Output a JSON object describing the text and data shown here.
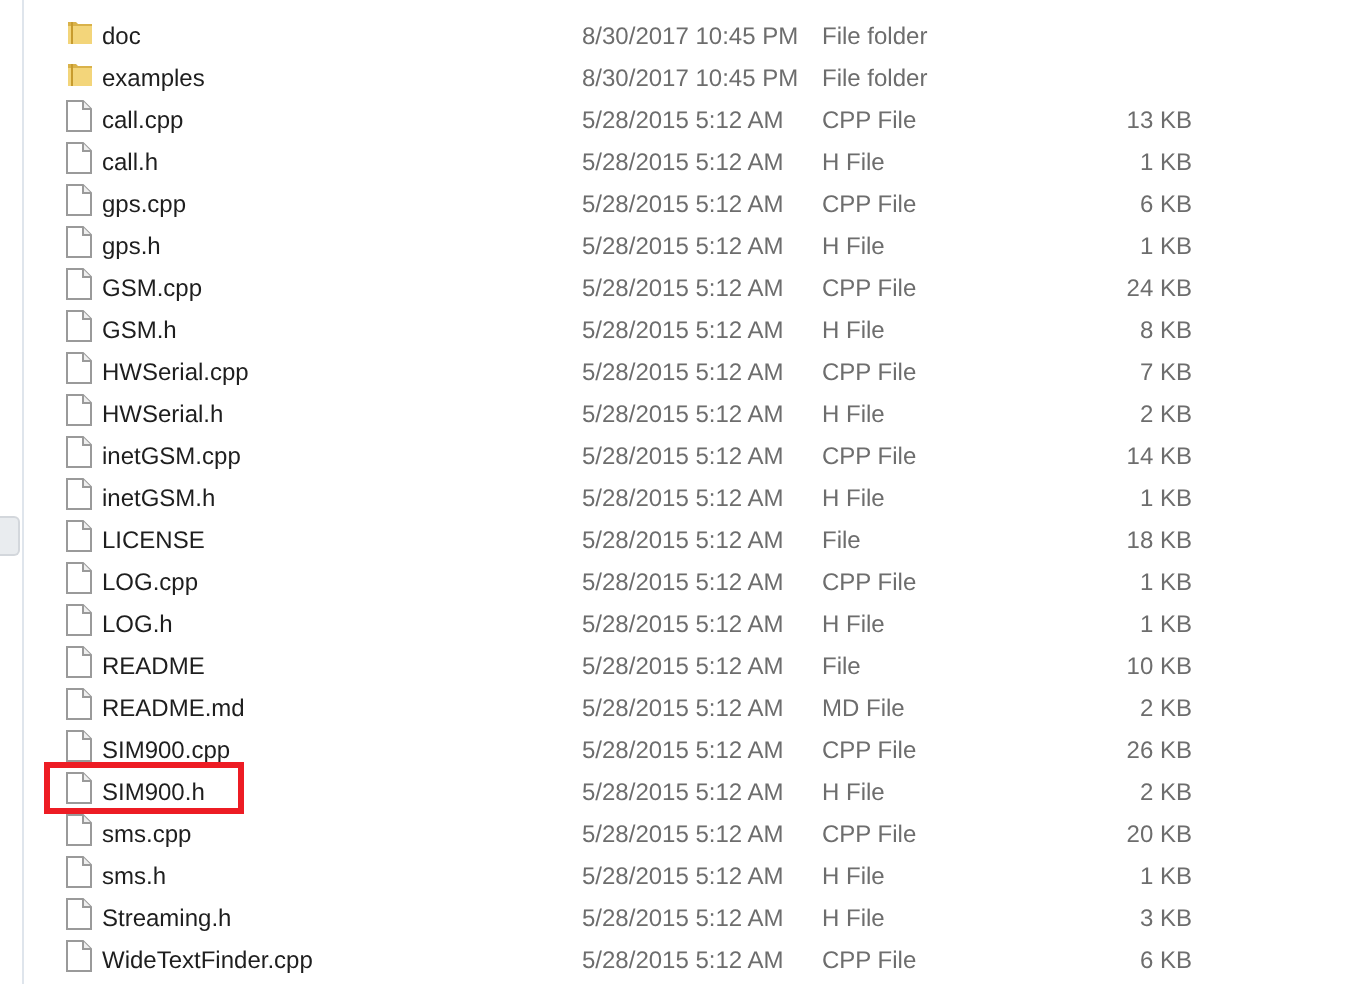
{
  "files": [
    {
      "kind": "folder",
      "name": "doc",
      "date": "8/30/2017 10:45 PM",
      "type": "File folder",
      "highlighted": false
    },
    {
      "kind": "folder",
      "name": "examples",
      "date": "8/30/2017 10:45 PM",
      "type": "File folder",
      "highlighted": false
    },
    {
      "kind": "file",
      "name": "call.cpp",
      "date": "5/28/2015 5:12 AM",
      "type": "CPP File",
      "size": "13 KB",
      "highlighted": false
    },
    {
      "kind": "file",
      "name": "call.h",
      "date": "5/28/2015 5:12 AM",
      "type": "H File",
      "size": "1 KB",
      "highlighted": false
    },
    {
      "kind": "file",
      "name": "gps.cpp",
      "date": "5/28/2015 5:12 AM",
      "type": "CPP File",
      "size": "6 KB",
      "highlighted": false
    },
    {
      "kind": "file",
      "name": "gps.h",
      "date": "5/28/2015 5:12 AM",
      "type": "H File",
      "size": "1 KB",
      "highlighted": false
    },
    {
      "kind": "file",
      "name": "GSM.cpp",
      "date": "5/28/2015 5:12 AM",
      "type": "CPP File",
      "size": "24 KB",
      "highlighted": false
    },
    {
      "kind": "file",
      "name": "GSM.h",
      "date": "5/28/2015 5:12 AM",
      "type": "H File",
      "size": "8 KB",
      "highlighted": false
    },
    {
      "kind": "file",
      "name": "HWSerial.cpp",
      "date": "5/28/2015 5:12 AM",
      "type": "CPP File",
      "size": "7 KB",
      "highlighted": false
    },
    {
      "kind": "file",
      "name": "HWSerial.h",
      "date": "5/28/2015 5:12 AM",
      "type": "H File",
      "size": "2 KB",
      "highlighted": false
    },
    {
      "kind": "file",
      "name": "inetGSM.cpp",
      "date": "5/28/2015 5:12 AM",
      "type": "CPP File",
      "size": "14 KB",
      "highlighted": false
    },
    {
      "kind": "file",
      "name": "inetGSM.h",
      "date": "5/28/2015 5:12 AM",
      "type": "H File",
      "size": "1 KB",
      "highlighted": false
    },
    {
      "kind": "file",
      "name": "LICENSE",
      "date": "5/28/2015 5:12 AM",
      "type": "File",
      "size": "18 KB",
      "highlighted": false
    },
    {
      "kind": "file",
      "name": "LOG.cpp",
      "date": "5/28/2015 5:12 AM",
      "type": "CPP File",
      "size": "1 KB",
      "highlighted": false
    },
    {
      "kind": "file",
      "name": "LOG.h",
      "date": "5/28/2015 5:12 AM",
      "type": "H File",
      "size": "1 KB",
      "highlighted": false
    },
    {
      "kind": "file",
      "name": "README",
      "date": "5/28/2015 5:12 AM",
      "type": "File",
      "size": "10 KB",
      "highlighted": false
    },
    {
      "kind": "file",
      "name": "README.md",
      "date": "5/28/2015 5:12 AM",
      "type": "MD File",
      "size": "2 KB",
      "highlighted": false
    },
    {
      "kind": "file",
      "name": "SIM900.cpp",
      "date": "5/28/2015 5:12 AM",
      "type": "CPP File",
      "size": "26 KB",
      "highlighted": false
    },
    {
      "kind": "file",
      "name": "SIM900.h",
      "date": "5/28/2015 5:12 AM",
      "type": "H File",
      "size": "2 KB",
      "highlighted": true
    },
    {
      "kind": "file",
      "name": "sms.cpp",
      "date": "5/28/2015 5:12 AM",
      "type": "CPP File",
      "size": "20 KB",
      "highlighted": false
    },
    {
      "kind": "file",
      "name": "sms.h",
      "date": "5/28/2015 5:12 AM",
      "type": "H File",
      "size": "1 KB",
      "highlighted": false
    },
    {
      "kind": "file",
      "name": "Streaming.h",
      "date": "5/28/2015 5:12 AM",
      "type": "H File",
      "size": "3 KB",
      "highlighted": false
    },
    {
      "kind": "file",
      "name": "WideTextFinder.cpp",
      "date": "5/28/2015 5:12 AM",
      "type": "CPP File",
      "size": "6 KB",
      "highlighted": false
    }
  ]
}
